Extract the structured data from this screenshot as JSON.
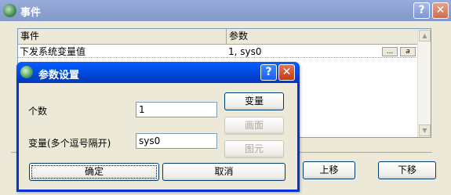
{
  "window": {
    "title": "事件",
    "help_label": "?",
    "close_label": "✕"
  },
  "grid": {
    "columns": [
      "事件",
      "参数"
    ],
    "rows": [
      {
        "event": "下发系统变量值",
        "params": "1, sys0",
        "btn1": "...",
        "btn2": "a"
      }
    ]
  },
  "main_buttons": {
    "up": "上移",
    "down": "下移"
  },
  "dialog": {
    "title": "参数设置",
    "help_label": "?",
    "close_label": "✕",
    "count_label": "个数",
    "count_value": "1",
    "var_label": "变量(多个逗号隔开)",
    "var_value": "sys0",
    "btn_variable": "变量",
    "btn_screen": "画面",
    "btn_element": "图元",
    "btn_ok": "确定",
    "btn_cancel": "取消"
  },
  "icons": {
    "app": "app-globe-icon",
    "scroll_up": "scroll-up-arrow-icon",
    "scroll_down": "scroll-down-arrow-icon"
  },
  "colors": {
    "dialog_title": "#0053ee",
    "inactive_title": "#8ea3d2"
  }
}
